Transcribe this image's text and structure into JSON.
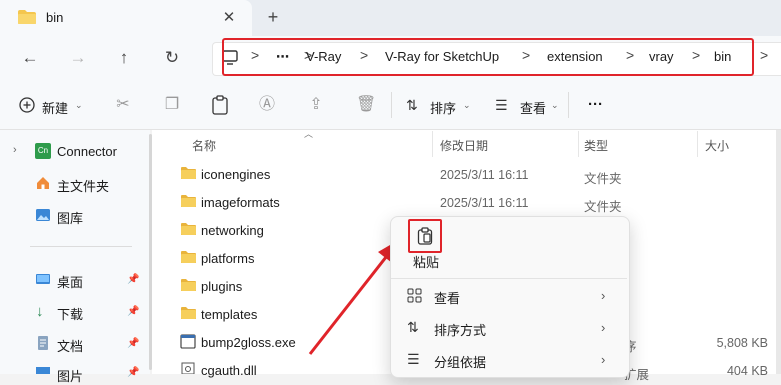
{
  "tab": {
    "title": "bin",
    "close": "✕",
    "new": "+"
  },
  "nav": {
    "back": "←",
    "forward": "→",
    "up": "↑",
    "refresh": "↻"
  },
  "breadcrumb": {
    "more": "⋯",
    "items": [
      "V-Ray",
      "V-Ray for SketchUp",
      "extension",
      "vray",
      "bin"
    ],
    "separator": ">"
  },
  "toolbar": {
    "new_label": "新建",
    "sort_label": "排序",
    "view_label": "查看",
    "more": "···"
  },
  "sidebar": {
    "items": [
      {
        "label": "Connector",
        "icon": "connector-app-icon"
      },
      {
        "label": "主文件夹",
        "icon": "home-icon"
      },
      {
        "label": "图库",
        "icon": "gallery-icon"
      },
      {
        "label": "桌面",
        "icon": "desktop-icon",
        "pinned": true
      },
      {
        "label": "下载",
        "icon": "download-icon",
        "pinned": true
      },
      {
        "label": "文档",
        "icon": "documents-icon",
        "pinned": true
      },
      {
        "label": "图片",
        "icon": "pictures-icon",
        "pinned": true
      }
    ]
  },
  "columns": {
    "name": "名称",
    "date": "修改日期",
    "type": "类型",
    "size": "大小"
  },
  "files": [
    {
      "name": "iconengines",
      "date": "2025/3/11 16:11",
      "type": "文件夹",
      "size": "",
      "icon": "folder-icon"
    },
    {
      "name": "imageformats",
      "date": "2025/3/11 16:11",
      "type": "文件夹",
      "size": "",
      "icon": "folder-icon"
    },
    {
      "name": "networking",
      "date": "",
      "type": "",
      "size": "",
      "icon": "folder-icon"
    },
    {
      "name": "platforms",
      "date": "",
      "type": "",
      "size": "",
      "icon": "folder-icon"
    },
    {
      "name": "plugins",
      "date": "",
      "type": "",
      "size": "",
      "icon": "folder-icon"
    },
    {
      "name": "templates",
      "date": "",
      "type": "",
      "size": "",
      "icon": "folder-icon"
    },
    {
      "name": "bump2gloss.exe",
      "date": "",
      "type": "序",
      "size": "5,808 KB",
      "icon": "exe-icon"
    },
    {
      "name": "cgauth.dll",
      "date": "",
      "type": "扩展",
      "size": "404 KB",
      "icon": "dll-icon"
    }
  ],
  "context_menu": {
    "paste_label": "粘贴",
    "items": [
      {
        "label": "查看",
        "icon": "grid-view-icon"
      },
      {
        "label": "排序方式",
        "icon": "sort-icon"
      },
      {
        "label": "分组依据",
        "icon": "group-icon"
      }
    ],
    "chevron": "›"
  },
  "colors": {
    "highlight": "#e0242a",
    "folder": "#f4c64e",
    "accent": "#0067c0"
  }
}
